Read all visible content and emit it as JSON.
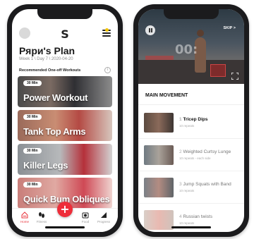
{
  "left_screen": {
    "logo_text": "S",
    "plan_title": "Ряри's Plan",
    "plan_subtitle": "Week 1 \\ Day 7 \\ 2020-04-20",
    "section_title": "Recommended One-off Workouts",
    "info_glyph": "i",
    "workouts": [
      {
        "duration": "30 Min",
        "name": "Power Workout"
      },
      {
        "duration": "30 Min",
        "name": "Tank Top Arms"
      },
      {
        "duration": "30 Min",
        "name": "Killer Legs"
      },
      {
        "duration": "30 Min",
        "name": "Quick Bum Obliques"
      }
    ],
    "tabs": [
      {
        "label": "Home",
        "icon": "home-icon",
        "active": true
      },
      {
        "label": "Fitness",
        "icon": "footprints-icon",
        "active": false
      },
      {
        "label": "Food",
        "icon": "food-icon",
        "active": false
      },
      {
        "label": "Progress",
        "icon": "progress-icon",
        "active": false
      }
    ],
    "fab_glyph": "+",
    "colors": {
      "accent": "#ee2d39",
      "notification": "#f5c400"
    }
  },
  "right_screen": {
    "video_timer": "00:",
    "skip_label": "SKIP >",
    "section_title": "MAIN MOVEMENT",
    "exercises": [
      {
        "number": "1",
        "name": "Tricep Dips",
        "reps": "10 repeats",
        "active": true
      },
      {
        "number": "2",
        "name": "Weighted Curtsy Lunge",
        "reps": "10 repeats - each side",
        "active": false
      },
      {
        "number": "3",
        "name": "Jump Squats with Band",
        "reps": "10 repeats",
        "active": false
      },
      {
        "number": "4",
        "name": "Russian twists",
        "reps": "10 repeats",
        "active": false
      }
    ]
  }
}
